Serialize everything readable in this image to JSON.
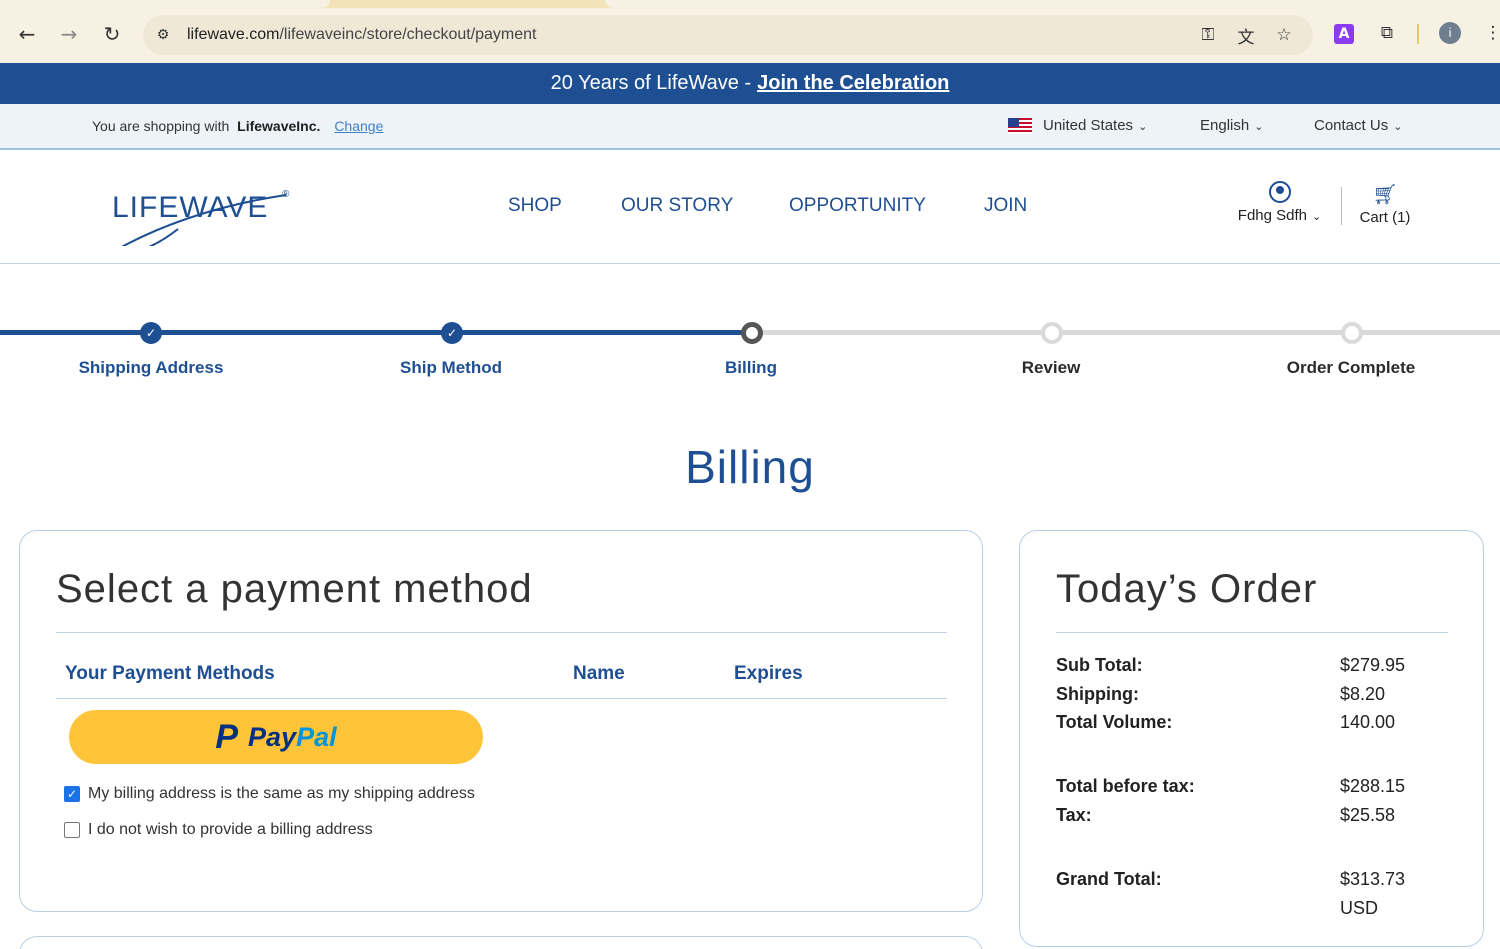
{
  "browser": {
    "url_host": "lifewave.com",
    "url_path": "/lifewaveinc/store/checkout/payment",
    "extension_label": "A",
    "profile_label": "i"
  },
  "announcement": {
    "text": "20 Years of LifeWave -",
    "link": "Join the Celebration"
  },
  "utility": {
    "shopping_prefix": "You are shopping with",
    "shopping_with": "LifewaveInc.",
    "change_link": "Change",
    "country": "United States",
    "language": "English",
    "contact": "Contact Us"
  },
  "header": {
    "logo_text": "LIFEWAVE",
    "logo_mark": "®",
    "nav": [
      "SHOP",
      "OUR STORY",
      "OPPORTUNITY",
      "JOIN"
    ],
    "account_name": "Fdhg Sdfh",
    "cart_label": "Cart (1)"
  },
  "steps": [
    {
      "label": "Shipping Address",
      "state": "done"
    },
    {
      "label": "Ship Method",
      "state": "done"
    },
    {
      "label": "Billing",
      "state": "current"
    },
    {
      "label": "Review",
      "state": "todo"
    },
    {
      "label": "Order Complete",
      "state": "todo"
    }
  ],
  "page_title": "Billing",
  "payment": {
    "title": "Select a payment method",
    "columns": [
      "Your Payment Methods",
      "Name",
      "Expires"
    ],
    "paypal_pay": "Pay",
    "paypal_pal": "Pal",
    "same_address_label": "My billing address is the same as my shipping address",
    "same_address_checked": true,
    "no_billing_label": "I do not wish to provide a billing address",
    "no_billing_checked": false
  },
  "order": {
    "title": "Today’s Order",
    "sub_total_label": "Sub Total:",
    "sub_total": "$279.95",
    "shipping_label": "Shipping:",
    "shipping": "$8.20",
    "volume_label": "Total Volume:",
    "volume": "140.00",
    "before_tax_label": "Total before tax:",
    "before_tax": "$288.15",
    "tax_label": "Tax:",
    "tax": "$25.58",
    "grand_label": "Grand Total:",
    "grand_total": "$313.73",
    "currency": "USD"
  },
  "colors": {
    "brand_blue": "#1f4f93",
    "paypal_yellow": "#ffc43a",
    "checkbox_blue": "#1a73e8"
  }
}
